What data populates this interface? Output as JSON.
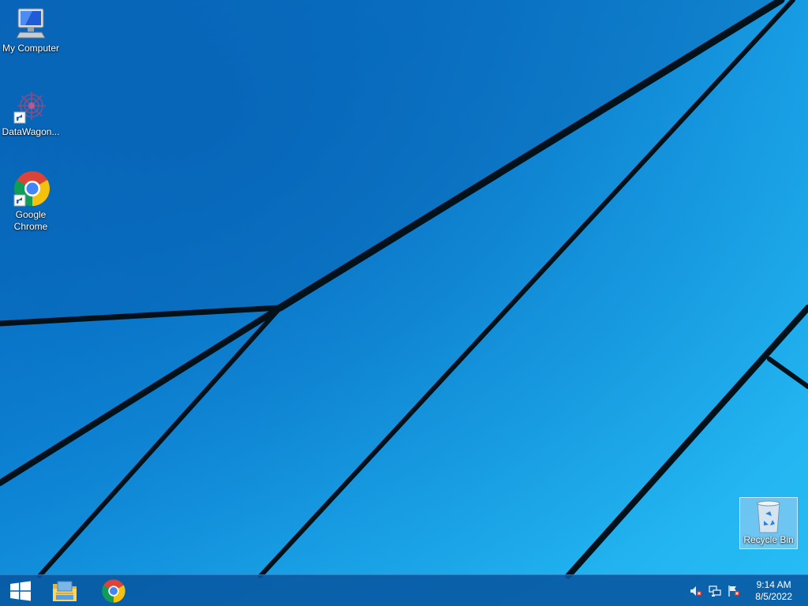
{
  "desktop": {
    "icons": [
      {
        "label": "My Computer",
        "icon": "computer-icon"
      },
      {
        "label": "DataWagon...",
        "icon": "datawagon-icon"
      },
      {
        "label": "Google Chrome",
        "icon": "chrome-icon"
      },
      {
        "label": "Recycle Bin",
        "icon": "recycle-bin-icon"
      }
    ]
  },
  "taskbar": {
    "start": {
      "icon": "windows-logo-icon"
    },
    "pinned": [
      {
        "icon": "file-explorer-icon"
      },
      {
        "icon": "chrome-icon"
      }
    ],
    "tray": [
      {
        "icon": "volume-muted-icon"
      },
      {
        "icon": "network-icon"
      },
      {
        "icon": "action-center-flag-icon"
      }
    ],
    "clock": {
      "time": "9:14 AM",
      "date": "8/5/2022"
    }
  },
  "colors": {
    "wallpaper_blue": "#0d86d8",
    "taskbar": "#0856a0",
    "selection": "#aad2f0"
  }
}
